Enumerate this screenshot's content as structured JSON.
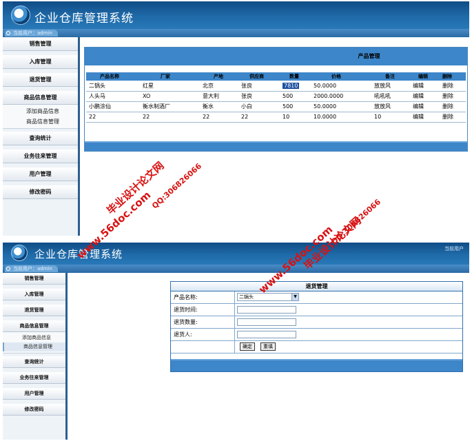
{
  "app": {
    "title": "企业仓库管理系统",
    "user_label": "当前用户：admin",
    "header_user": "当前用户"
  },
  "sidebar": {
    "items": [
      {
        "label": "销售管理"
      },
      {
        "label": "入库管理"
      },
      {
        "label": "退货管理"
      },
      {
        "label": "商品信息管理"
      }
    ],
    "subitems": [
      {
        "label": "添加商品信息"
      },
      {
        "label": "商品信息管理"
      }
    ],
    "items_after": [
      {
        "label": "查询统计"
      },
      {
        "label": "业务往来管理"
      },
      {
        "label": "用户管理"
      },
      {
        "label": "修改密码"
      }
    ]
  },
  "product_panel": {
    "title": "产品管理",
    "columns": [
      "产品名称",
      "厂家",
      "产地",
      "供应商",
      "数量",
      "价格",
      "备注",
      "编辑",
      "删除"
    ],
    "rows": [
      [
        "二锅头",
        "红星",
        "北京",
        "张良",
        "7810",
        "50.0000",
        "放放风",
        "编辑",
        "删除"
      ],
      [
        "人头马",
        "XO",
        "意大利",
        "张良",
        "500",
        "2000.0000",
        "吼吼吼",
        "编辑",
        "删除"
      ],
      [
        "小鹏涂仙",
        "衡水制酒厂",
        "衡水",
        "小白",
        "500",
        "50.0000",
        "放放风",
        "编辑",
        "删除"
      ],
      [
        "22",
        "22",
        "22",
        "22",
        "10",
        "10.0000",
        "10",
        "编辑",
        "删除"
      ]
    ]
  },
  "return_form": {
    "title": "退货管理",
    "product_label": "产品名称:",
    "product_value": "二锅头",
    "time_label": "退货时间:",
    "qty_label": "退货数量:",
    "person_label": "退货人:",
    "confirm": "确定",
    "reset": "重填"
  },
  "watermarks": {
    "site_cn": "毕业设计论文网",
    "url": "www.56doc.com",
    "qq": "QQ:306826066"
  },
  "colors": {
    "header": "#1f6aa8",
    "panel_bar": "#3d86c9",
    "watermark": "#d81212"
  }
}
